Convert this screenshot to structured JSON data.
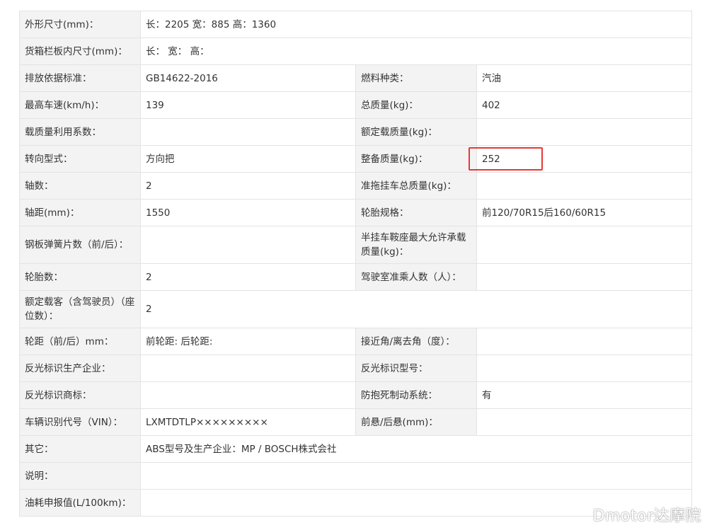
{
  "rows": [
    {
      "label": "外形尺寸(mm)：",
      "value": "长：2205 宽：885 高：1360"
    },
    {
      "label": "货箱栏板内尺寸(mm)：",
      "value": "长： 宽： 高："
    },
    {
      "label": "排放依据标准：",
      "value": "GB14622-2016",
      "label2": "燃料种类：",
      "value2": "汽油"
    },
    {
      "label": "最高车速(km/h)：",
      "value": "139",
      "label2": "总质量(kg)：",
      "value2": "402"
    },
    {
      "label": "载质量利用系数：",
      "value": "",
      "label2": "额定载质量(kg)：",
      "value2": ""
    },
    {
      "label": "转向型式：",
      "value": "方向把",
      "label2": "整备质量(kg)：",
      "value2": "252"
    },
    {
      "label": "轴数：",
      "value": "2",
      "label2": "准拖挂车总质量(kg)：",
      "value2": ""
    },
    {
      "label": "轴距(mm)：",
      "value": "1550",
      "label2": "轮胎规格：",
      "value2": "前120/70R15后160/60R15"
    },
    {
      "label": "钢板弹簧片数（前/后）：",
      "value": "",
      "label2": "半挂车鞍座最大允许承载质量(kg)：",
      "value2": ""
    },
    {
      "label": "轮胎数：",
      "value": "2",
      "label2": "驾驶室准乘人数（人）：",
      "value2": ""
    },
    {
      "label": "额定载客（含驾驶员）（座位数）：",
      "value": "2"
    },
    {
      "label": "轮距（前/后）mm：",
      "value": "前轮距: 后轮距:",
      "label2": "接近角/离去角（度）：",
      "value2": ""
    },
    {
      "label": "反光标识生产企业：",
      "value": "",
      "label2": "反光标识型号：",
      "value2": ""
    },
    {
      "label": "反光标识商标：",
      "value": "",
      "label2": "防抱死制动系统：",
      "value2": "有"
    },
    {
      "label": "车辆识别代号（VIN）：",
      "value": "LXMTDTLP×××××××××",
      "label2": "前悬/后悬(mm)：",
      "value2": ""
    },
    {
      "label": "其它：",
      "value": "ABS型号及生产企业：MP / BOSCH株式会社"
    },
    {
      "label": "说明：",
      "value": ""
    },
    {
      "label": "油耗申报值(L/100km)：",
      "value": ""
    }
  ],
  "watermark": "Dmotor达摩院",
  "colors": {
    "label_bg": "#f3f3f3",
    "border": "#e3e3e3",
    "highlight": "#e53935",
    "text": "#333333"
  }
}
